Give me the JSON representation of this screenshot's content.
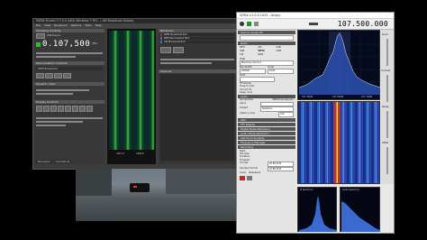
{
  "left_app": {
    "title": "SDR# Studio Cl 7.0.0 (x64) Windows 7 SP1 — AM Broadcast Display",
    "menu": [
      "File",
      "View",
      "Receivers",
      "Options",
      "Tools",
      "Help"
    ],
    "sampling": {
      "header": "Sampling Controls",
      "device_label": "SDR Device",
      "frequency": "0.107,500",
      "unit": "MHz"
    },
    "demod": {
      "header": "Demodulation Controls",
      "mode_value": "WFM Broadcast"
    },
    "squelch_header": "Squelch / Gain",
    "display_header": "Display Controls",
    "waterfall_ticks": [
      "107.0",
      "108.0"
    ],
    "receivers": {
      "header": "Receivers",
      "items": [
        "WFM Broadcast Rx1",
        "NFM Narrowband Rx2",
        "AM Broadcast Rx3"
      ]
    },
    "scanner_header": "Scanner",
    "tabs": [
      "Receivers",
      "Commands"
    ]
  },
  "right_app": {
    "title": "SDR# v1.0.0.1432 - Airspy",
    "frequency": "107.500.000",
    "source_header": "Source: Airspy R2",
    "radio_header": "Radio",
    "modes": [
      "NFM",
      "AM",
      "LSB",
      "USB",
      "WFM",
      "DSB",
      "CW",
      "RAW"
    ],
    "filter_label": "Filter",
    "filter_value": "Blackman-Harris 4",
    "bandwidth_label": "Bandwidth",
    "bandwidth_value": "200000",
    "order_label": "Order",
    "order_value": "1000",
    "shift_label": "Shift",
    "fm_stereo": "FM Stereo",
    "snap_label": "Snap to Grid",
    "correct_iq": "Correct IQ",
    "swap_iq": "Swap I & Q",
    "audio_header": "Audio",
    "samplerate_label": "Samplerate",
    "samplerate_value": "48000 sample/sec",
    "input_label": "Input",
    "output_label": "Output",
    "output_value": "Speakers",
    "latency_label": "Latency (ms)",
    "latency_value": "100",
    "sections": [
      "AGC",
      "FFT Display",
      "Digital Noise Reduction",
      "Audio Noise Reduction",
      "Spectrum Analyzer",
      "Frequency Manager",
      "Recording"
    ],
    "rec_fields": [
      {
        "label": "Start",
        "value": ""
      },
      {
        "label": "File Size",
        "value": ""
      },
      {
        "label": "Duration",
        "value": ""
      },
      {
        "label": "Dropped",
        "value": ""
      },
      {
        "label": "Format",
        "value": "16 Bit PCM"
      },
      {
        "label": "Sample Format",
        "value": "16 Bit PCM"
      }
    ],
    "rec_audio_label": "Audio",
    "rec_baseband_label": "Baseband",
    "spectrum_ticks": [
      "107.300M",
      "107.500M",
      "107.700M"
    ],
    "side_labels": [
      "Zoom",
      "Contrast",
      "Range",
      "Offset"
    ],
    "mini_labels": [
      "IF Spectrum",
      "Audio Spectrum"
    ],
    "colors": {
      "waterfall_blue": "#2a45a5",
      "peak_red": "#c03030",
      "panel_dark": "#555555"
    }
  },
  "video": {
    "caption": "camera view"
  }
}
